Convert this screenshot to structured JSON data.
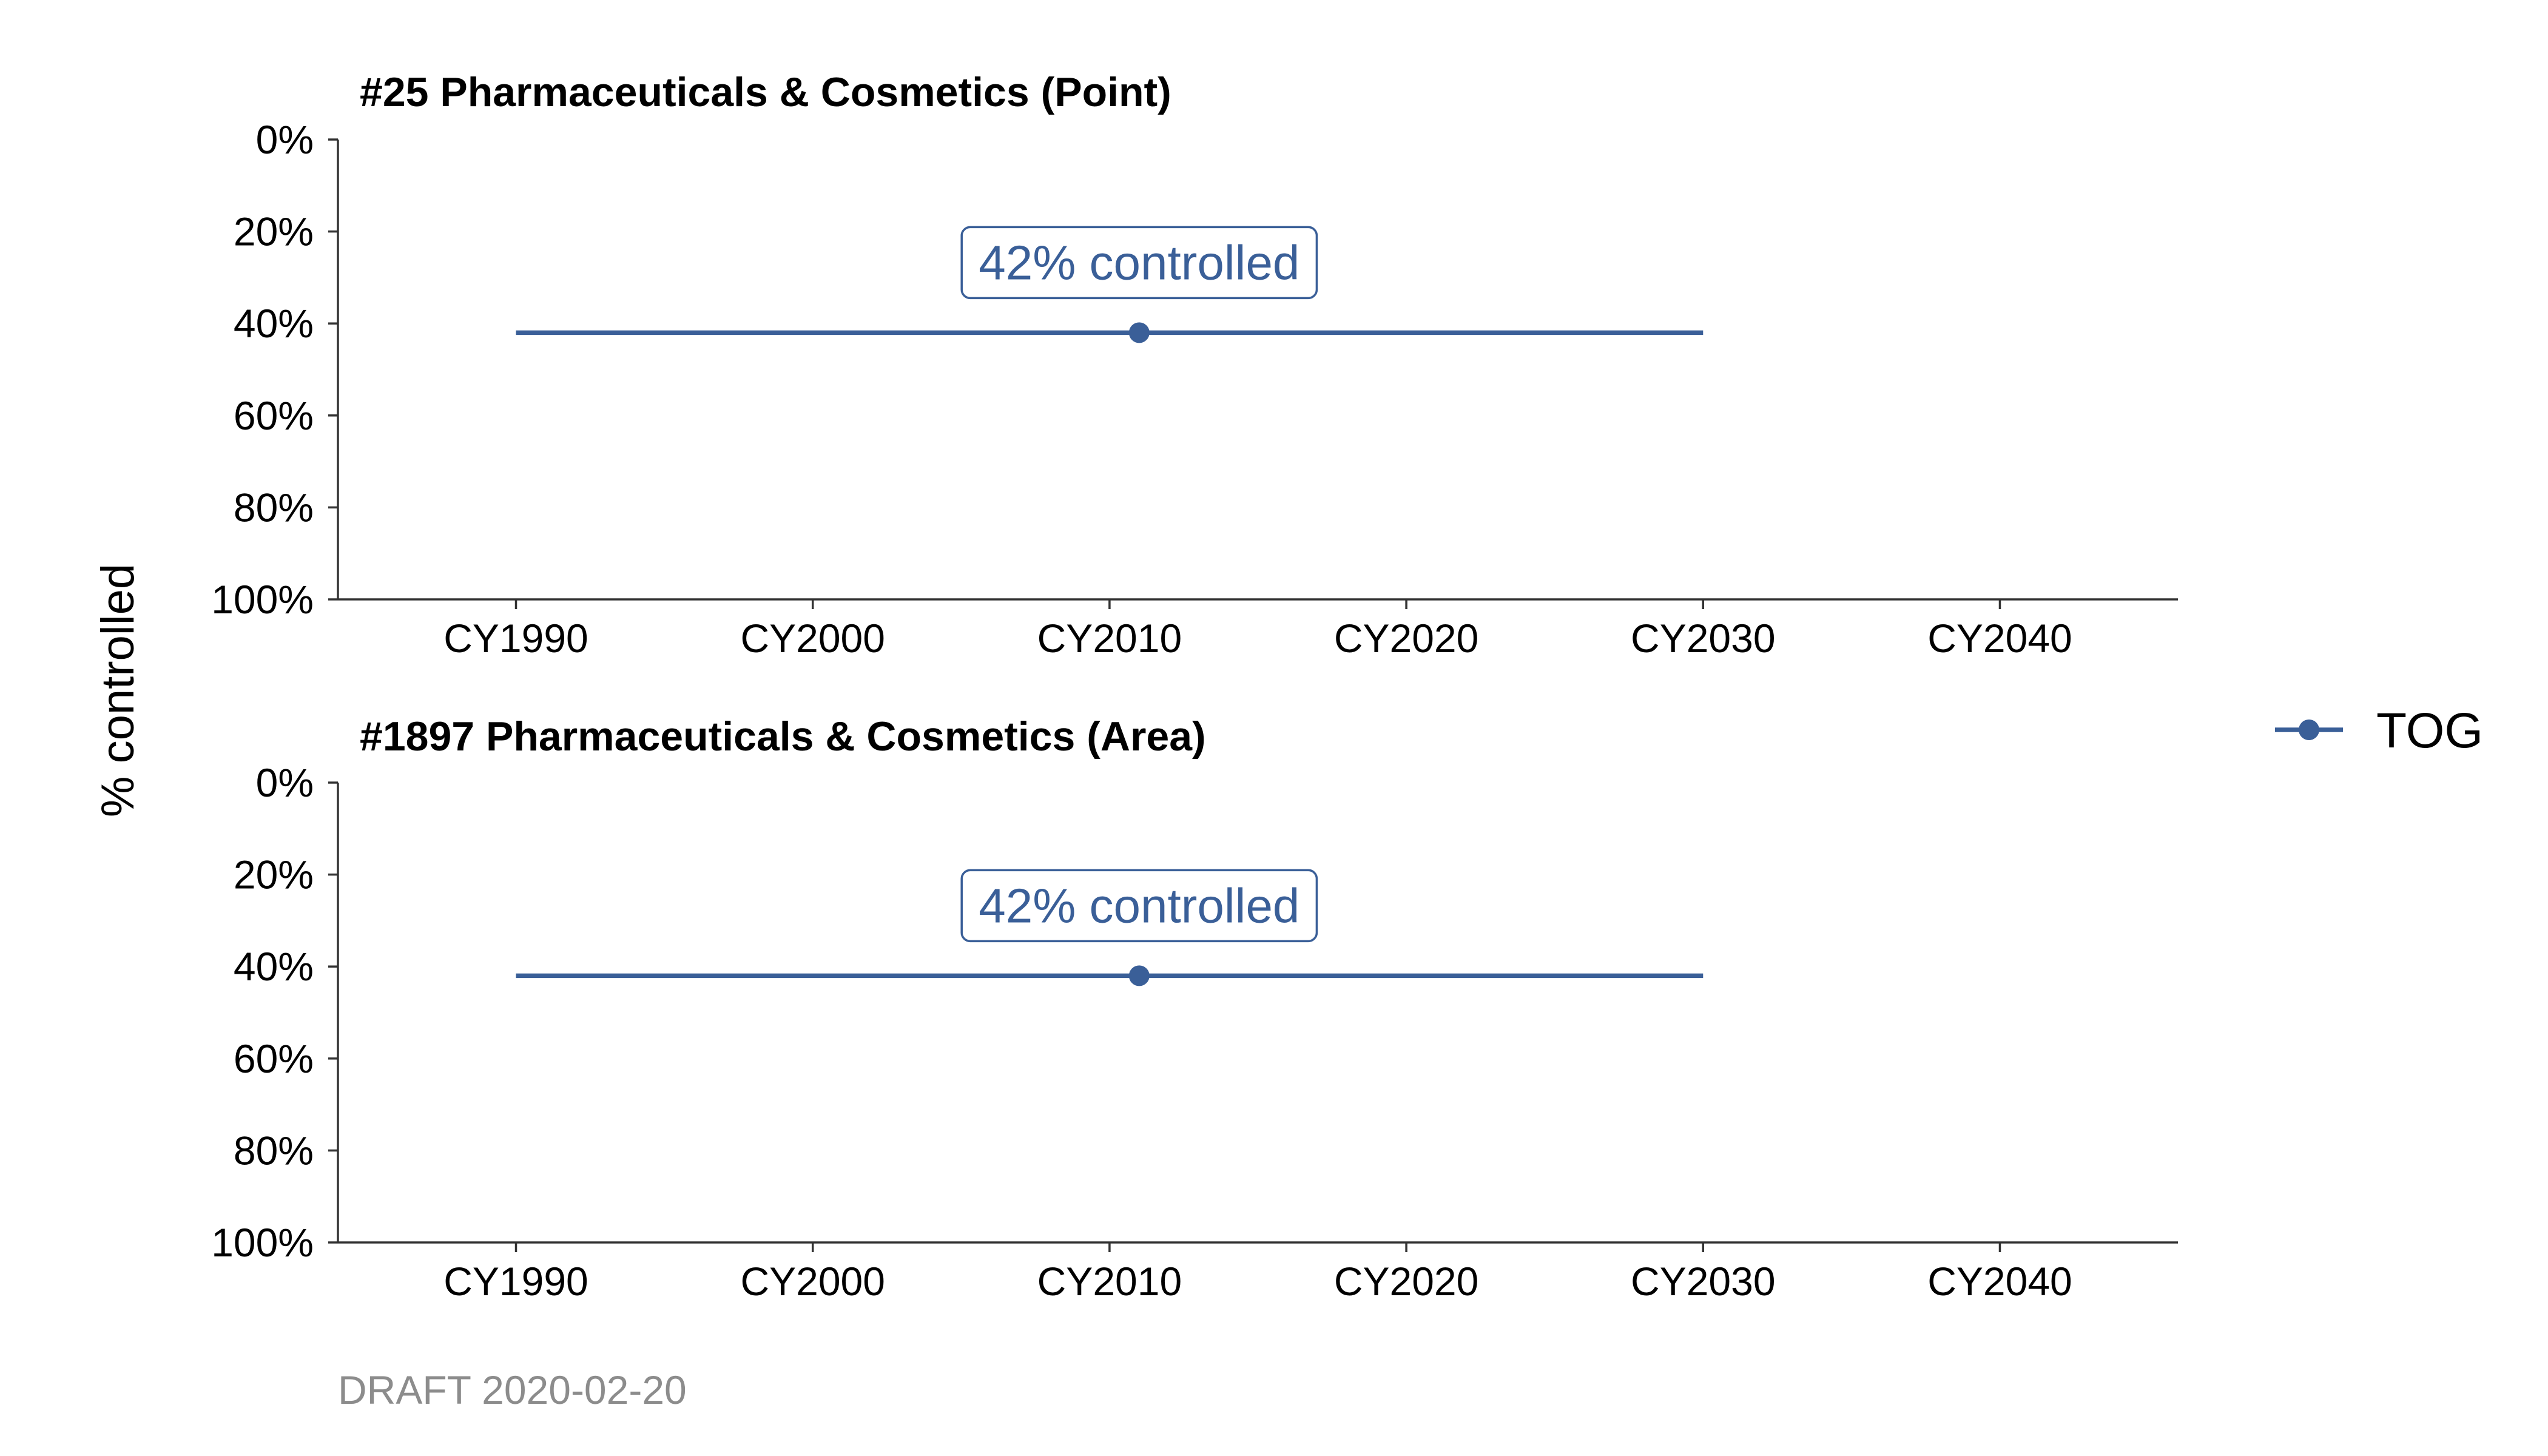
{
  "chart_data": {
    "type": "line",
    "ylabel": "% controlled",
    "legend": {
      "position": "right",
      "entries": [
        {
          "name": "TOG",
          "color": "#3A5F98"
        }
      ]
    },
    "footer": "DRAFT 2020-02-20",
    "footer_color": "#8C8C8C",
    "panels": [
      {
        "title": "#25 Pharmaceuticals & Cosmetics (Point)",
        "x_ticks": [
          1990,
          2000,
          2010,
          2020,
          2030,
          2040
        ],
        "x_tick_labels": [
          "CY1990",
          "CY2000",
          "CY2010",
          "CY2020",
          "CY2030",
          "CY2040"
        ],
        "xlim": [
          1984,
          2046
        ],
        "y_ticks": [
          0,
          20,
          40,
          60,
          80,
          100
        ],
        "y_tick_labels": [
          "0%",
          "20%",
          "40%",
          "60%",
          "80%",
          "100%"
        ],
        "ylim": [
          0,
          100
        ],
        "y_reversed": true,
        "series": [
          {
            "name": "TOG",
            "color": "#3A5F98",
            "line": {
              "x": [
                1990,
                2030
              ],
              "y": [
                42,
                42
              ]
            },
            "point": {
              "x": 2011,
              "y": 42
            }
          }
        ],
        "annotation": {
          "text": "42% controlled",
          "x": 2011,
          "y": 42
        }
      },
      {
        "title": "#1897 Pharmaceuticals & Cosmetics (Area)",
        "x_ticks": [
          1990,
          2000,
          2010,
          2020,
          2030,
          2040
        ],
        "x_tick_labels": [
          "CY1990",
          "CY2000",
          "CY2010",
          "CY2020",
          "CY2030",
          "CY2040"
        ],
        "xlim": [
          1984,
          2046
        ],
        "y_ticks": [
          0,
          20,
          40,
          60,
          80,
          100
        ],
        "y_tick_labels": [
          "0%",
          "20%",
          "40%",
          "60%",
          "80%",
          "100%"
        ],
        "ylim": [
          0,
          100
        ],
        "y_reversed": true,
        "series": [
          {
            "name": "TOG",
            "color": "#3A5F98",
            "line": {
              "x": [
                1990,
                2030
              ],
              "y": [
                42,
                42
              ]
            },
            "point": {
              "x": 2011,
              "y": 42
            }
          }
        ],
        "annotation": {
          "text": "42% controlled",
          "x": 2011,
          "y": 42
        }
      }
    ]
  }
}
